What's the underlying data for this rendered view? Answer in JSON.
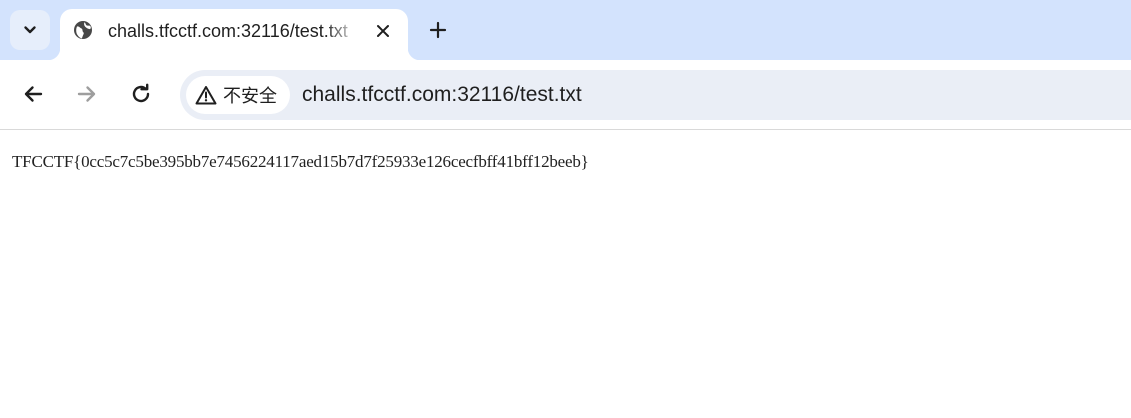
{
  "browser": {
    "tab": {
      "title": "challs.tfcctf.com:32116/test.txt",
      "favicon": "globe-icon",
      "close_icon": "close-icon"
    },
    "tab_search_icon": "chevron-down-icon",
    "new_tab_icon": "plus-icon",
    "nav": {
      "back_icon": "arrow-left-icon",
      "forward_icon": "arrow-right-icon",
      "reload_icon": "reload-icon"
    },
    "omnibox": {
      "security_icon": "warning-icon",
      "security_label": "不安全",
      "url": "challs.tfcctf.com:32116/test.txt"
    }
  },
  "page": {
    "text": "TFCCTF{0cc5c7c5be395bb7e7456224117aed15b7d7f25933e126cecfbff41bff12beeb}"
  },
  "colors": {
    "tabstrip_bg": "#d3e3fd",
    "omnibox_bg": "#eaeef6",
    "text": "#1f1f1f",
    "disabled_icon": "#9e9e9e"
  }
}
